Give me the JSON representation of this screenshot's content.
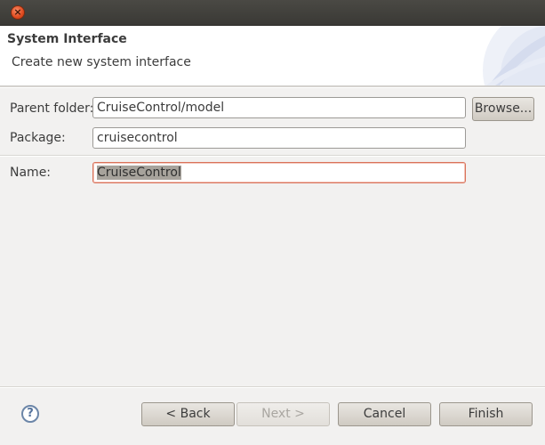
{
  "window": {
    "close_glyph": "×"
  },
  "banner": {
    "title": "System Interface",
    "description": "Create new system interface"
  },
  "form": {
    "parent_folder": {
      "label": "Parent folder:",
      "value": "CruiseControl/model"
    },
    "browse_label": "Browse...",
    "package": {
      "label": "Package:",
      "value": "cruisecontrol"
    },
    "name": {
      "label": "Name:",
      "value": "CruiseControl"
    }
  },
  "footer": {
    "help_glyph": "?",
    "back_label": "< Back",
    "next_label": "Next >",
    "cancel_label": "Cancel",
    "finish_label": "Finish"
  },
  "colors": {
    "accent_error_border": "#d9725a",
    "titlebar": "#3c3b37"
  }
}
